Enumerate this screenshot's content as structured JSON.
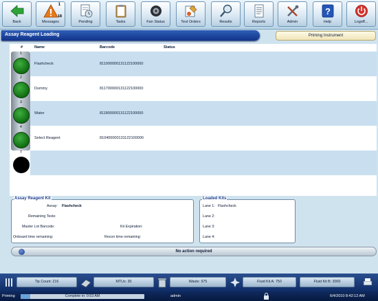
{
  "toolbar": {
    "buttons": [
      {
        "label": "Back",
        "icon": "back-arrow-icon"
      },
      {
        "label": "Messages",
        "icon": "warning-icon",
        "badge": "1",
        "badge2": "18"
      },
      {
        "label": "Pending",
        "icon": "pending-document-icon"
      },
      {
        "label": "Tasks",
        "icon": "clipboard-icon"
      },
      {
        "label": "Fan Status",
        "icon": "fan-icon"
      },
      {
        "label": "Test Orders",
        "icon": "test-orders-icon"
      },
      {
        "label": "Results",
        "icon": "magnifier-icon"
      },
      {
        "label": "Reports",
        "icon": "report-icon"
      },
      {
        "label": "Admin",
        "icon": "tools-icon"
      },
      {
        "label": "Help",
        "icon": "help-icon"
      },
      {
        "label": "Logoff...",
        "icon": "power-icon"
      }
    ]
  },
  "header": {
    "title": "Assay Reagent Loading",
    "priming_button": "Priming Instrument"
  },
  "table": {
    "columns": [
      "#",
      "Name",
      "Barcode",
      "Status"
    ],
    "rows": [
      {
        "slot": "1",
        "name": "Flashcheck",
        "barcode": "811000000131122100000",
        "status": ""
      },
      {
        "slot": "2",
        "name": "Dummy",
        "barcode": "811700000131122100000",
        "status": ""
      },
      {
        "slot": "3",
        "name": "Water",
        "barcode": "811800000131122100000",
        "status": ""
      },
      {
        "slot": "4",
        "name": "Select Reagent",
        "barcode": "810400000131122100000",
        "status": ""
      },
      {
        "slot": "5",
        "name": "",
        "barcode": "",
        "status": ""
      },
      {
        "slot": "",
        "name": "",
        "barcode": "",
        "status": ""
      }
    ],
    "slot_labels": [
      "1",
      "2",
      "3",
      "4",
      "5",
      "T"
    ]
  },
  "assay_kit": {
    "title": "Assay Reagent Kit",
    "assay_label": "Assay:",
    "assay_value": "Flashcheck",
    "remaining_tests_label": "Remaining Tests:",
    "master_lot_label": "Master Lot Barcode:",
    "kit_expiration_label": "Kit Expiration:",
    "onboard_label": "Onboard time remaining:",
    "recon_label": "Recon time remaining:"
  },
  "loaded_kits": {
    "title": "Loaded Kits",
    "lanes": [
      {
        "label": "Lane 1:",
        "value": "Flashcheck"
      },
      {
        "label": "Lane 2:",
        "value": ""
      },
      {
        "label": "Lane 3:",
        "value": ""
      },
      {
        "label": "Lane 4:",
        "value": ""
      }
    ]
  },
  "status_bar": {
    "message": "No action required"
  },
  "consumables": [
    {
      "label": "Tip Count: 216"
    },
    {
      "label": "MTUs: 30"
    },
    {
      "label": "Waste: 975"
    },
    {
      "label": "Fluid Kit A: 750"
    },
    {
      "label": "Fluid Kit B: 3000"
    }
  ],
  "footer": {
    "mode": "Priming",
    "progress_text": "Complete in: 0:53 AM",
    "progress_fraction": 0.08,
    "user": "admin",
    "datetime": "6/4/2010 8:42:12 AM"
  },
  "colors": {
    "header_blue": "#1a3f9a",
    "slot_green": "#138a16",
    "row_alt": "#c9dff0"
  }
}
